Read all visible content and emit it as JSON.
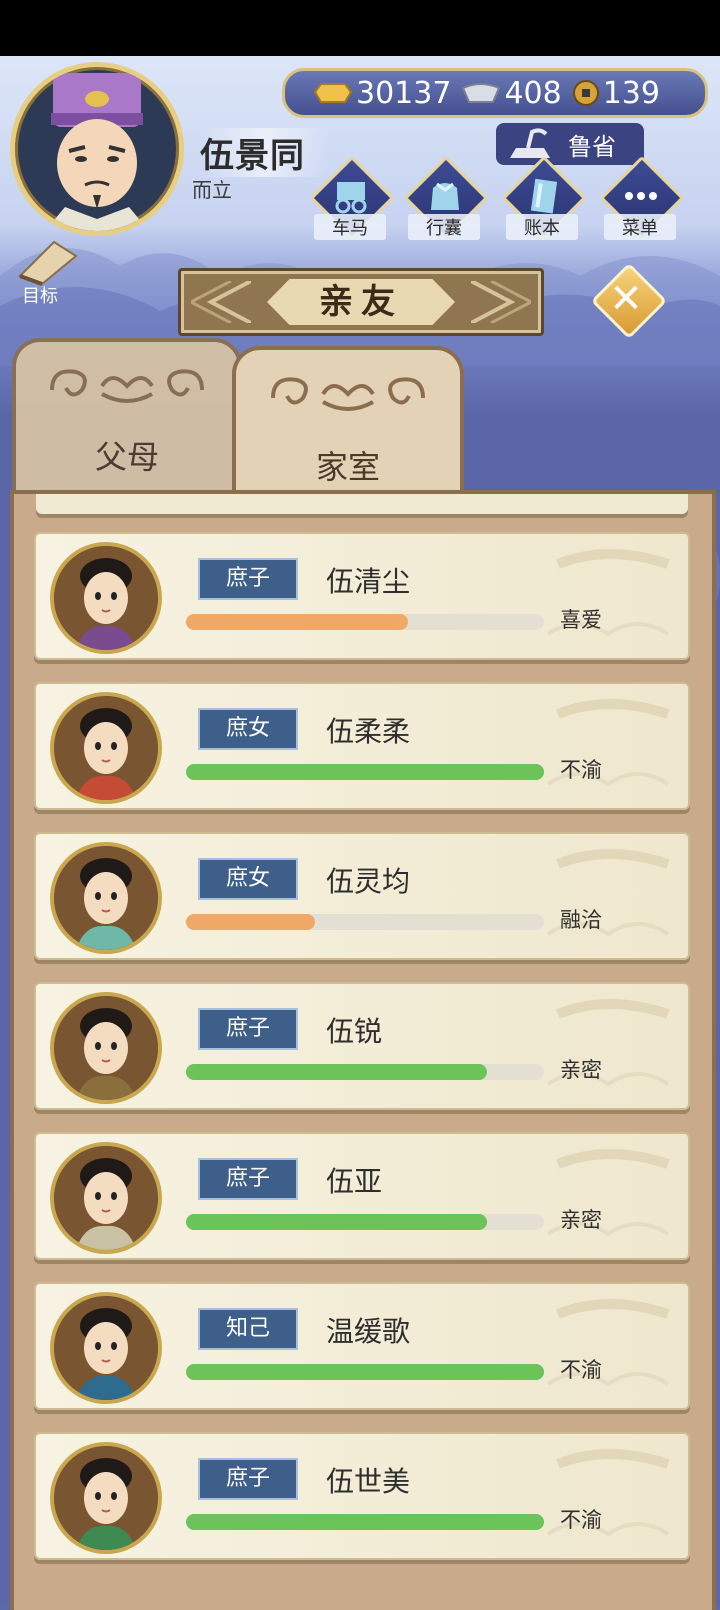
{
  "player": {
    "name": "伍景同",
    "age_label": "而立"
  },
  "currency": [
    {
      "icon": "gold-ingot-icon",
      "value": "30137"
    },
    {
      "icon": "silver-ingot-icon",
      "value": "408"
    },
    {
      "icon": "copper-coin-icon",
      "value": "139"
    }
  ],
  "location": "鲁省",
  "menu": [
    {
      "id": "carriage",
      "label": "车马",
      "icon": "carriage-icon"
    },
    {
      "id": "bag",
      "label": "行囊",
      "icon": "bag-icon"
    },
    {
      "id": "ledger",
      "label": "账本",
      "icon": "ledger-icon"
    },
    {
      "id": "menu",
      "label": "菜单",
      "icon": "more-icon"
    }
  ],
  "goal_label": "目标",
  "title": "亲友",
  "tabs": [
    {
      "label": "父母",
      "active": false
    },
    {
      "label": "家室",
      "active": true
    }
  ],
  "family": [
    {
      "relation": "庶子",
      "name": "伍清尘",
      "affinity": 0.62,
      "bar_color": "#f0a866",
      "mood": "喜爱"
    },
    {
      "relation": "庶女",
      "name": "伍柔柔",
      "affinity": 1.0,
      "bar_color": "#6cc35a",
      "mood": "不渝"
    },
    {
      "relation": "庶女",
      "name": "伍灵均",
      "affinity": 0.36,
      "bar_color": "#f0a866",
      "mood": "融洽"
    },
    {
      "relation": "庶子",
      "name": "伍锐",
      "affinity": 0.84,
      "bar_color": "#6cc35a",
      "mood": "亲密"
    },
    {
      "relation": "庶子",
      "name": "伍亚",
      "affinity": 0.84,
      "bar_color": "#6cc35a",
      "mood": "亲密"
    },
    {
      "relation": "知己",
      "name": "温缓歌",
      "affinity": 1.0,
      "bar_color": "#6cc35a",
      "mood": "不渝"
    },
    {
      "relation": "庶子",
      "name": "伍世美",
      "affinity": 1.0,
      "bar_color": "#6cc35a",
      "mood": "不渝"
    }
  ]
}
